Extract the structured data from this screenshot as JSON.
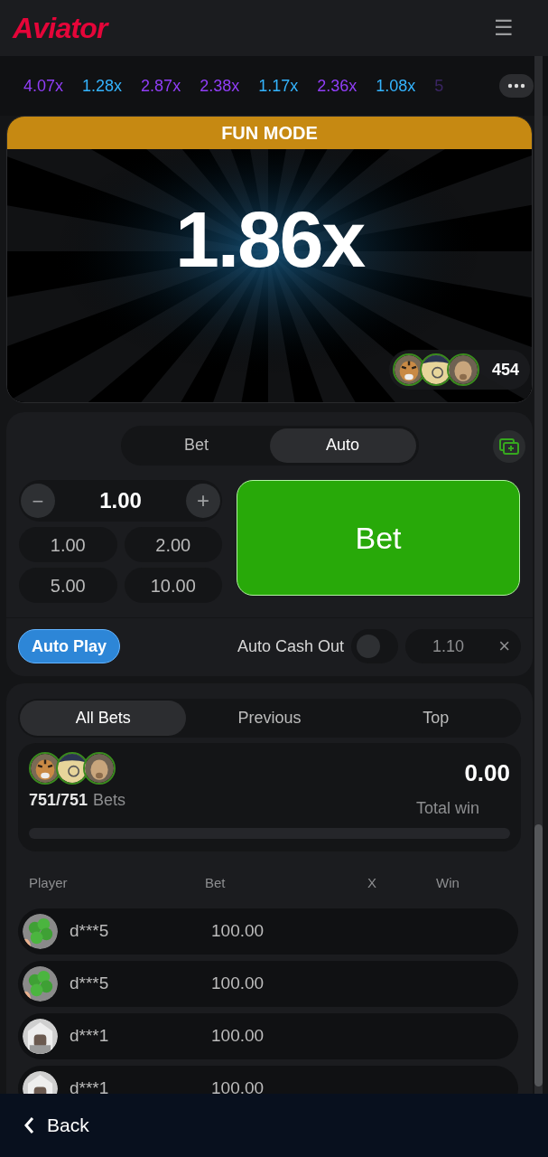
{
  "header": {
    "logo": "Aviator",
    "menu_icon": "☰"
  },
  "multipliers": [
    {
      "value": "4.07x",
      "color": "#913ef8"
    },
    {
      "value": "1.28x",
      "color": "#34b4ff"
    },
    {
      "value": "2.87x",
      "color": "#913ef8"
    },
    {
      "value": "2.38x",
      "color": "#913ef8"
    },
    {
      "value": "1.17x",
      "color": "#34b4ff"
    },
    {
      "value": "2.36x",
      "color": "#913ef8"
    },
    {
      "value": "1.08x",
      "color": "#34b4ff"
    },
    {
      "value": "5",
      "color": "#3a2563"
    }
  ],
  "game": {
    "banner": "FUN MODE",
    "multiplier": "1.86x",
    "players_count": "454"
  },
  "bet_panel": {
    "tabs": [
      {
        "label": "Bet",
        "selected": false
      },
      {
        "label": "Auto",
        "selected": true
      }
    ],
    "stepper": {
      "minus": "−",
      "value": "1.00",
      "plus": "+"
    },
    "quick_amounts": [
      "1.00",
      "2.00",
      "5.00",
      "10.00"
    ],
    "bet_button": "Bet",
    "auto_play": "Auto Play",
    "auto_cash_out": {
      "label": "Auto Cash Out",
      "on": false,
      "value": "1.10",
      "clear": "×"
    }
  },
  "bets": {
    "tabs": [
      {
        "label": "All Bets",
        "selected": true
      },
      {
        "label": "Previous",
        "selected": false
      },
      {
        "label": "Top",
        "selected": false
      }
    ],
    "count": "751/751",
    "count_label": "Bets",
    "total": "0.00",
    "total_label": "Total win",
    "level": 0,
    "columns": [
      "Player",
      "Bet",
      "X",
      "Win"
    ],
    "rows": [
      {
        "player": "d***5",
        "bet": "100.00"
      },
      {
        "player": "d***5",
        "bet": "100.00"
      },
      {
        "player": "d***1",
        "bet": "100.00"
      },
      {
        "player": "d***1",
        "bet": "100.00"
      }
    ]
  },
  "footer": {
    "back": "Back"
  }
}
